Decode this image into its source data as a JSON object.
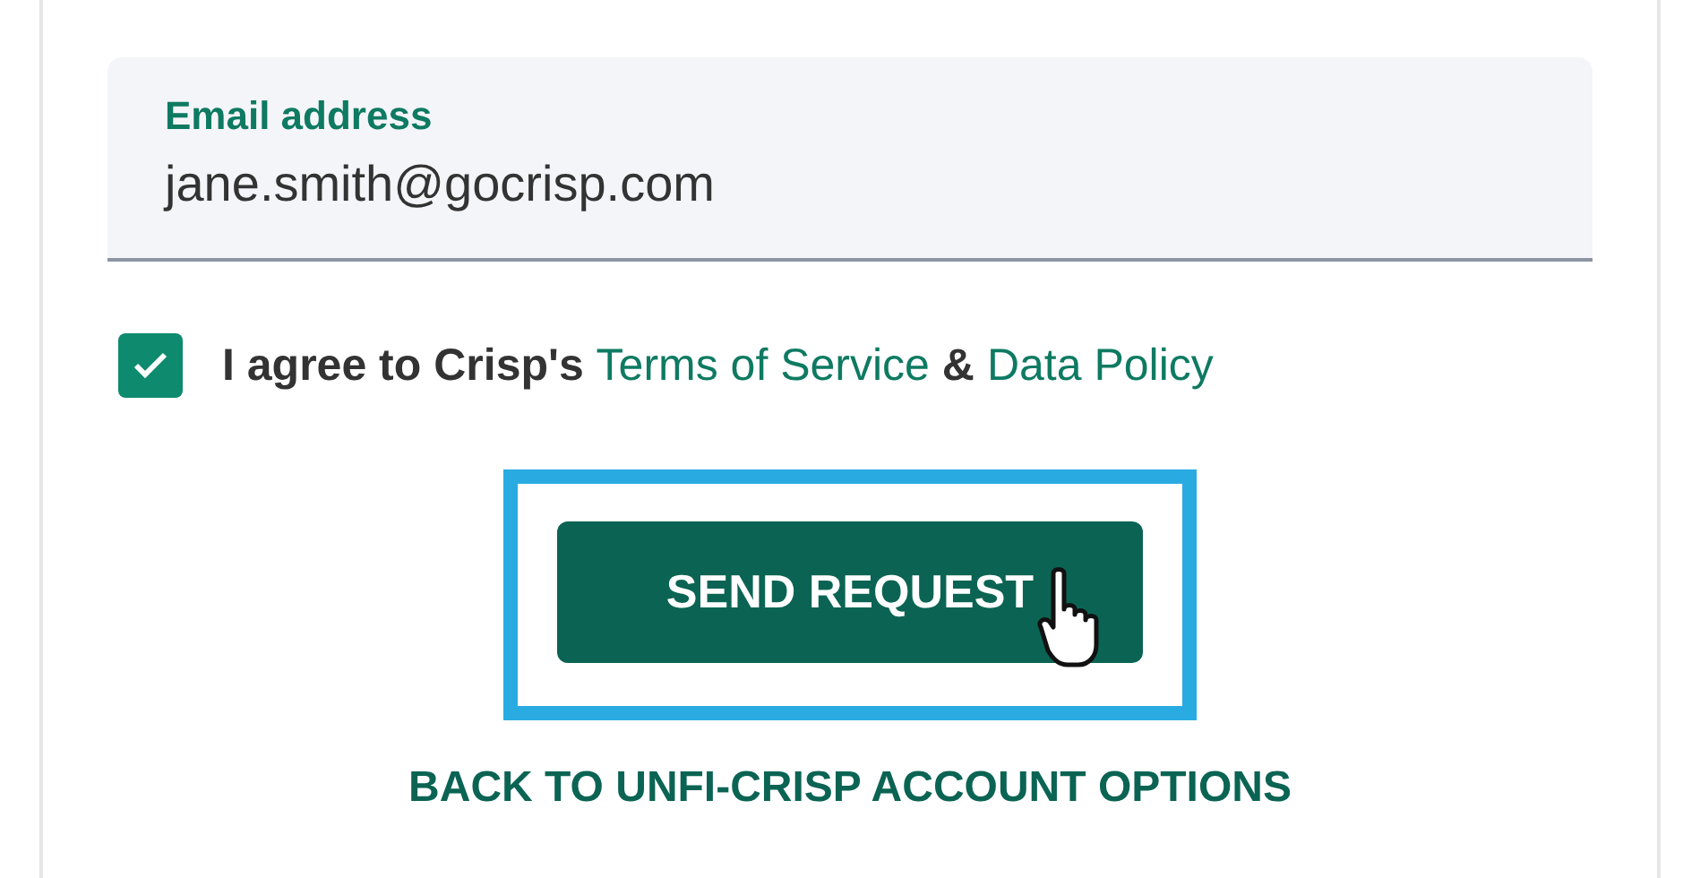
{
  "email_field": {
    "label": "Email address",
    "value": "jane.smith@gocrisp.com"
  },
  "agreement": {
    "checked": true,
    "parts": [
      {
        "kind": "text",
        "text": "I agree to Crisp's"
      },
      {
        "kind": "link",
        "text": "Terms of Service"
      },
      {
        "kind": "text",
        "text": "&"
      },
      {
        "kind": "link",
        "text": "Data Policy"
      }
    ]
  },
  "primary_button": {
    "label": "SEND REQUEST",
    "highlighted": true
  },
  "back_link": {
    "label": "BACK TO UNFI-CRISP ACCOUNT OPTIONS"
  }
}
